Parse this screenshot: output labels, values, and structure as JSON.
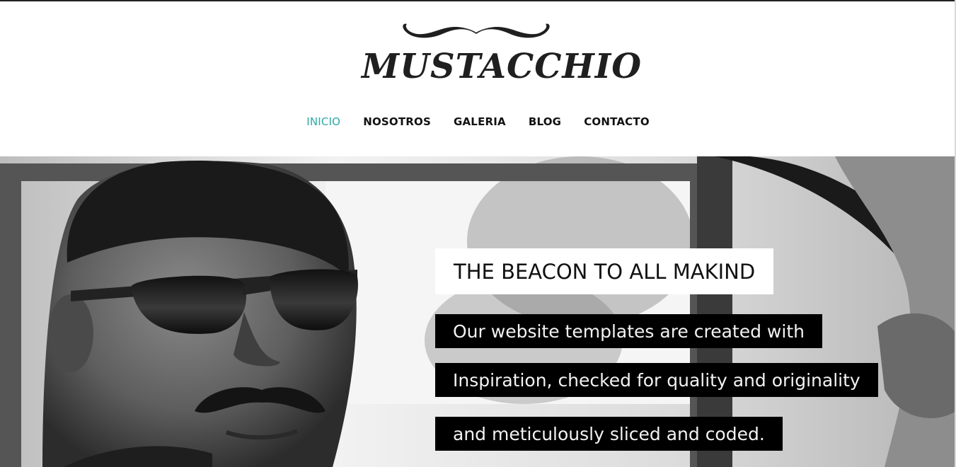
{
  "brand": {
    "name": "MUSTACCHIO"
  },
  "nav": {
    "items": [
      {
        "label": "INICIO",
        "active": true
      },
      {
        "label": "NOSOTROS",
        "active": false
      },
      {
        "label": "GALERIA",
        "active": false
      },
      {
        "label": "BLOG",
        "active": false
      },
      {
        "label": "CONTACTO",
        "active": false
      }
    ]
  },
  "hero": {
    "headline": "THE BEACON TO ALL MAKIND",
    "lines": [
      "Our website templates are created with",
      "Inspiration, checked for quality and originality",
      "and meticulously sliced and coded."
    ],
    "image": "man-with-sunglasses-in-car-photo"
  },
  "colors": {
    "accent": "#2aaaa4",
    "text": "#111111",
    "caption_bg": "#000000"
  }
}
